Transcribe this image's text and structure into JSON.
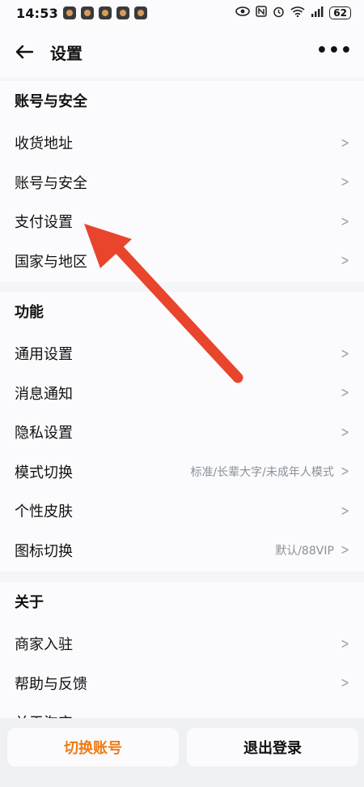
{
  "status_bar": {
    "time": "14:53",
    "battery": "62",
    "icons": [
      "eye-icon",
      "nfc-icon",
      "alarm-icon",
      "wifi-icon",
      "signal-icon"
    ]
  },
  "header": {
    "title": "设置",
    "more_label": "•••"
  },
  "sections": [
    {
      "title": "账号与安全",
      "items": [
        {
          "label": "收货地址",
          "value": ""
        },
        {
          "label": "账号与安全",
          "value": ""
        },
        {
          "label": "支付设置",
          "value": ""
        },
        {
          "label": "国家与地区",
          "value": ""
        }
      ]
    },
    {
      "title": "功能",
      "items": [
        {
          "label": "通用设置",
          "value": ""
        },
        {
          "label": "消息通知",
          "value": ""
        },
        {
          "label": "隐私设置",
          "value": ""
        },
        {
          "label": "模式切换",
          "value": "标准/长辈大字/未成年人模式"
        },
        {
          "label": "个性皮肤",
          "value": ""
        },
        {
          "label": "图标切换",
          "value": "默认/88VIP"
        }
      ]
    },
    {
      "title": "关于",
      "items": [
        {
          "label": "商家入驻",
          "value": ""
        },
        {
          "label": "帮助与反馈",
          "value": ""
        },
        {
          "label": "关于淘宝",
          "value": ""
        }
      ]
    }
  ],
  "bottom": {
    "switch_account": "切换账号",
    "logout": "退出登录"
  },
  "colors": {
    "accent_orange": "#f07a14",
    "annotation_arrow": "#e8452c"
  }
}
